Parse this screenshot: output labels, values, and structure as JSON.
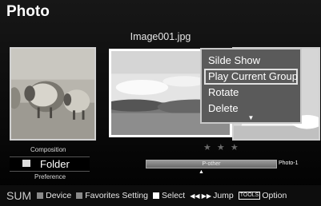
{
  "app": {
    "title": "Photo"
  },
  "viewer": {
    "file_name": "Image001.jpg",
    "rating": "★ ★ ★"
  },
  "context_menu": {
    "items": [
      "Silde Show",
      "Play Current Group",
      "Rotate",
      "Delete"
    ],
    "selected_index": 1,
    "more_indicator": "▼"
  },
  "sort_mode": {
    "above": "Composition",
    "current": "Folder",
    "below": "Preference"
  },
  "timeline": {
    "group_label": "P-other",
    "end_label": "Photo-1",
    "pointer": "▲"
  },
  "bottom_bar": {
    "sum": "SUM",
    "device": "Device",
    "favorites": "Favorites Setting",
    "select": "Select",
    "jump_icon": "◀◀ ▶▶",
    "jump": "Jump",
    "tools_icon": "TOOLS",
    "option": "Option"
  },
  "colors": {
    "background": "#000000",
    "menu_bg": "#5a5a5a",
    "menu_border": "#c8c8c8",
    "key_grey": "#8a8a8a"
  }
}
